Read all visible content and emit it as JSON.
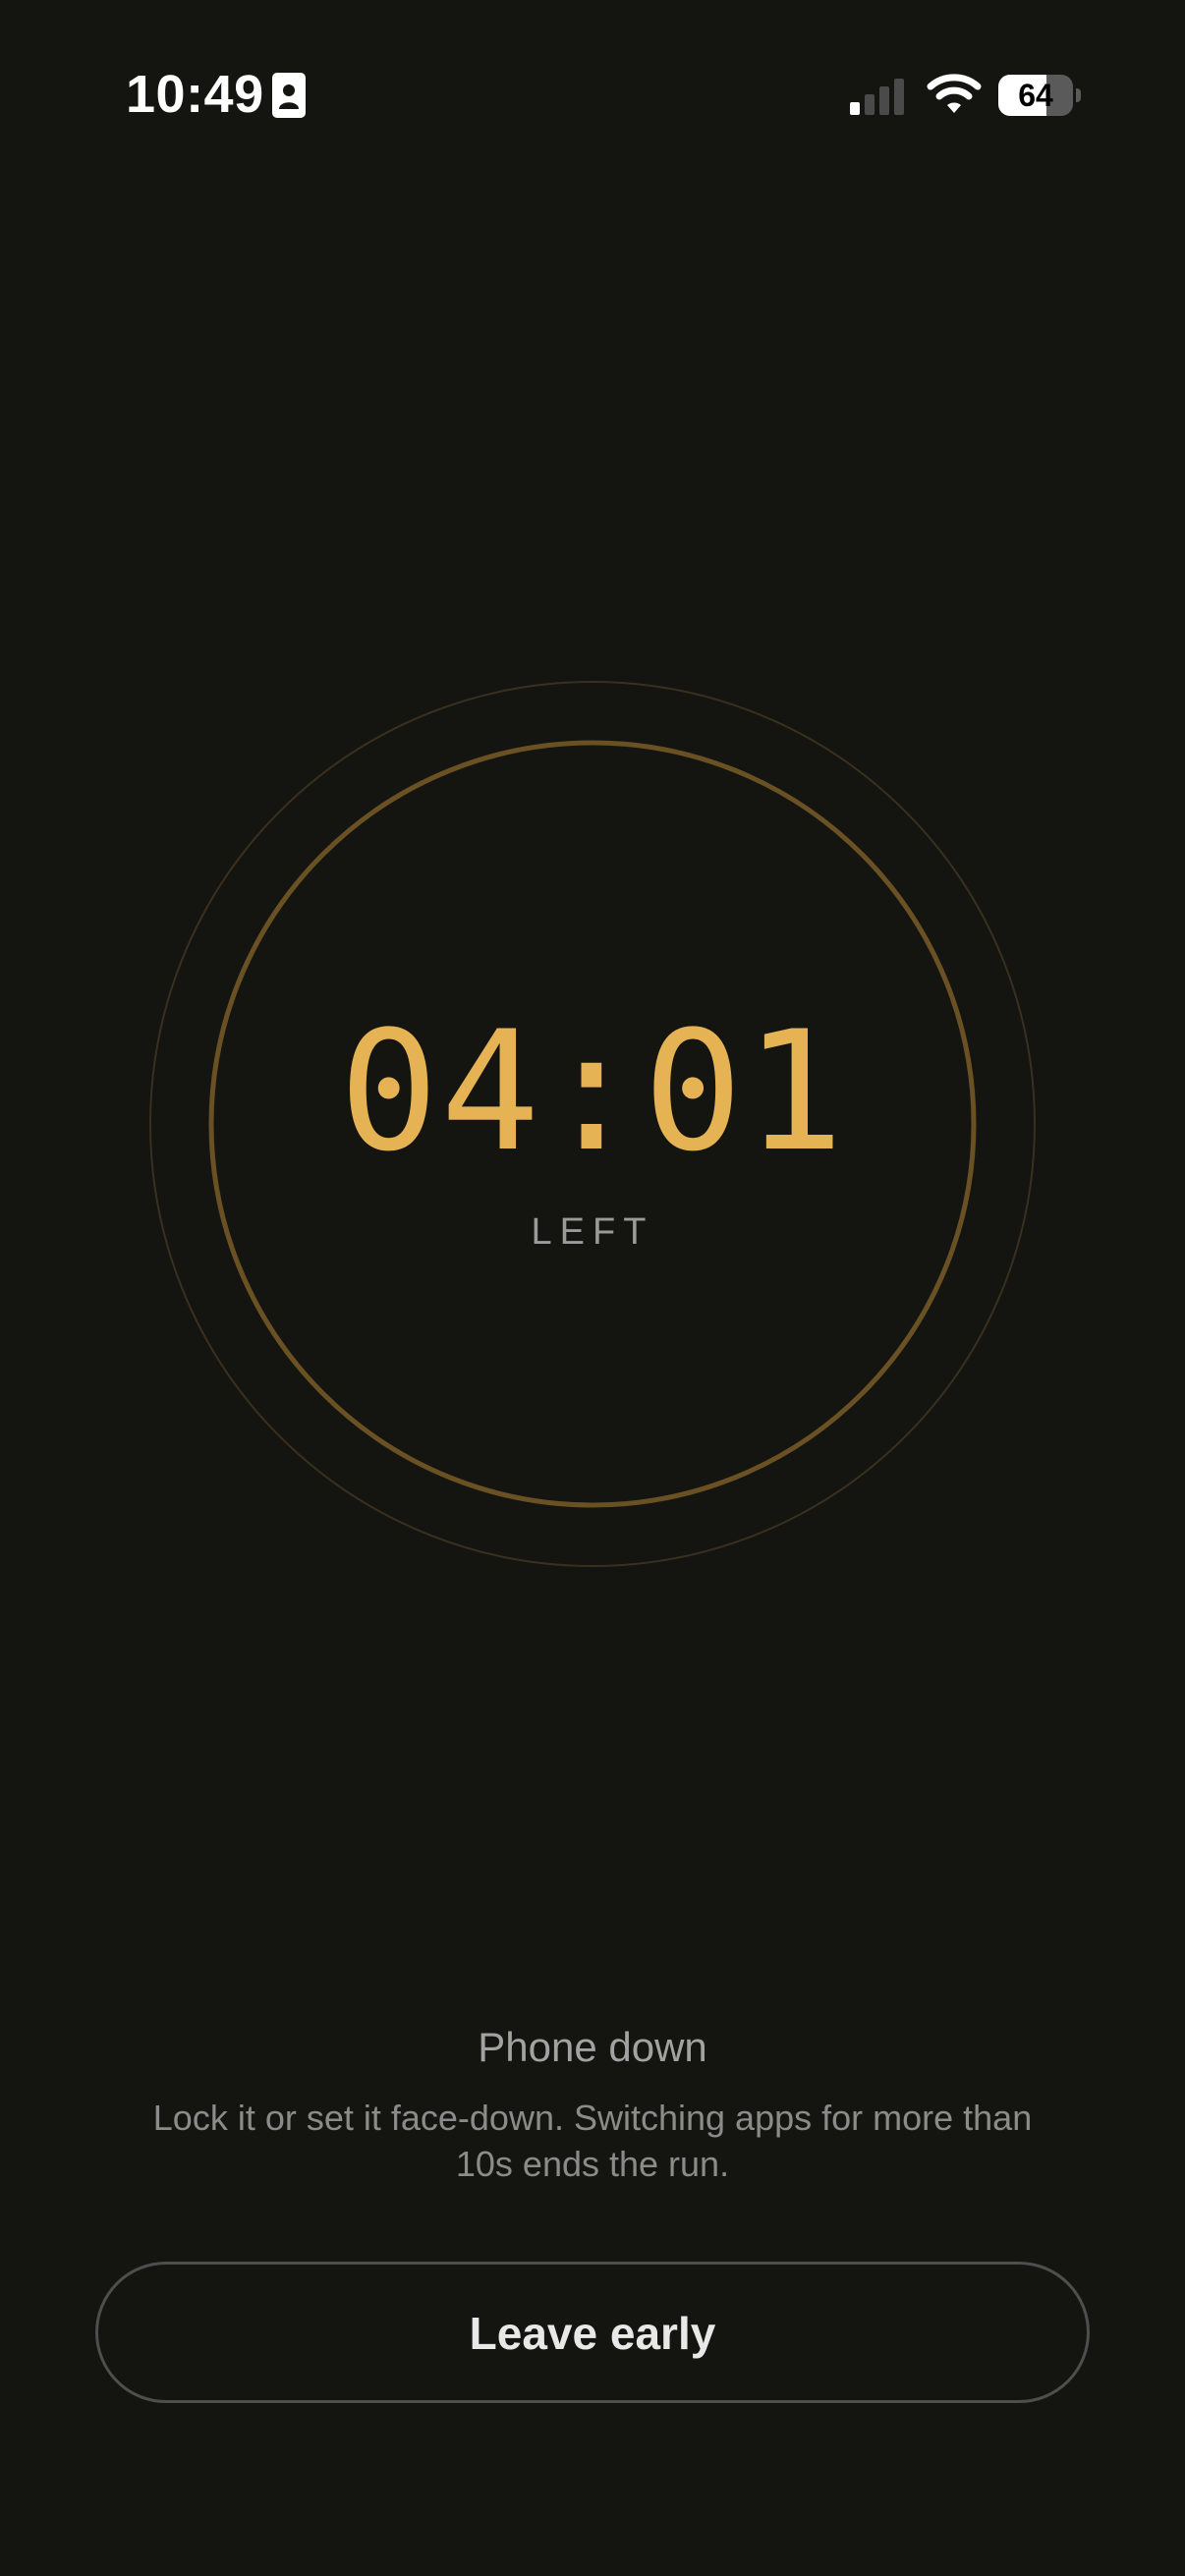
{
  "status_bar": {
    "time": "10:49",
    "battery_level": "64",
    "battery_fraction": 0.64,
    "signal_bars_active": 1,
    "signal_bars_total": 4,
    "icons": [
      "contact-card-icon",
      "cellular-signal-icon",
      "wifi-icon",
      "battery-icon"
    ]
  },
  "timer": {
    "value": "04:01",
    "caption": "LEFT"
  },
  "hint": {
    "title": "Phone down",
    "body": "Lock it or set it face-down. Switching apps for more than 10s ends the run."
  },
  "actions": {
    "leave_label": "Leave early"
  },
  "colors": {
    "background": "#141410",
    "accent": "#e6b354",
    "ring": "#6a5124",
    "button_border": "#4e4e4e"
  }
}
